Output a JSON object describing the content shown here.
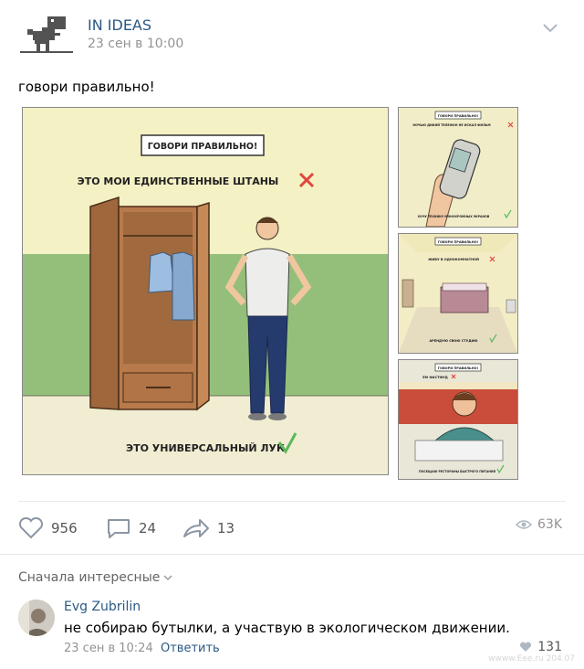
{
  "post": {
    "author": "IN IDEAS",
    "time": "23 сен в 10:00",
    "text": "говори правильно!"
  },
  "image_main": {
    "banner": "ГОВОРИ ПРАВИЛЬНО!",
    "wrong": "ЭТО МОИ ЕДИНСТВЕННЫЕ ШТАНЫ",
    "right": "ЭТО УНИВЕРСАЛЬНЫЙ ЛУК"
  },
  "thumbs": [
    {
      "banner": "ГОВОРИ ПРАВИЛЬНО!",
      "wrong": "НОЧЬЮ ДИКИЙ ТЕЛЕФОН НЕ ИСКАЛ ФИЛЬМ",
      "right": "ХОЧУ ТЕХНИКУ МОНОХРОМНЫХ ЭКРАНОВ"
    },
    {
      "banner": "ГОВОРИ ПРАВИЛЬНО!",
      "wrong": "ЖИВУ В ОДНОКОМНАТНОЙ",
      "right": "АРЕНДУЮ СВОЮ СТУДИЮ"
    },
    {
      "banner": "ГОВОРИ ПРАВИЛЬНО!",
      "wrong": "ЕМ ФАСТФУД",
      "right": "ПОСЕЩАЮ РЕСТОРАНЫ БЫСТРОГО ПИТАНИЯ"
    }
  ],
  "actions": {
    "likes": "956",
    "comments": "24",
    "shares": "13",
    "views": "63K"
  },
  "comments": {
    "sort_label": "Сначала интересные",
    "items": [
      {
        "author": "Evg Zubrilin",
        "text": "не собираю бутылки, а участвую в экологическом движении.",
        "time": "23 сен в 10:24",
        "reply": "Ответить",
        "likes": "131"
      }
    ]
  },
  "watermark": "wwww.Eee.ru 204.07"
}
